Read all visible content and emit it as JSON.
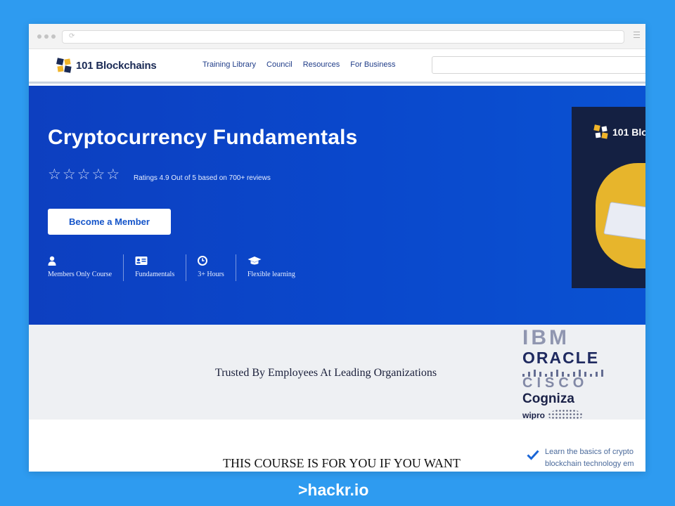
{
  "brand": {
    "footer_text": ">hackr.io"
  },
  "site": {
    "logo_text": "101 Blockchains",
    "nav_links": [
      "Training Library",
      "Council",
      "Resources",
      "For Business"
    ],
    "search_placeholder": ""
  },
  "hero": {
    "title": "Cryptocurrency Fundamentals",
    "rating_stars": 5,
    "rating_text": "Ratings 4.9 Out of 5 based on 700+ reviews",
    "cta_label": "Become a Member",
    "features": [
      {
        "icon": "user-icon",
        "label": "Members Only Course"
      },
      {
        "icon": "id-card-icon",
        "label": "Fundamentals"
      },
      {
        "icon": "clock-icon",
        "label": "3+ Hours"
      },
      {
        "icon": "graduation-cap-icon",
        "label": "Flexible learning"
      }
    ],
    "promo_card_logo": "101 Bloc"
  },
  "trusted": {
    "title": "Trusted By Employees At Leading Organizations",
    "logos": [
      "IBM",
      "ORACLE",
      "CISCO",
      "Cogniza",
      "wipro"
    ]
  },
  "course": {
    "heading": "THIS COURSE IS FOR YOU IF YOU WANT",
    "learn_line_1": "Learn the basics of crypto",
    "learn_line_2": "blockchain technology em"
  },
  "colors": {
    "page_background": "#2e9bf0",
    "hero_blue": "#0a48cc",
    "cta_text": "#1454c9",
    "nav_link": "#1f3c88",
    "promo_yellow": "#e7b52c"
  }
}
